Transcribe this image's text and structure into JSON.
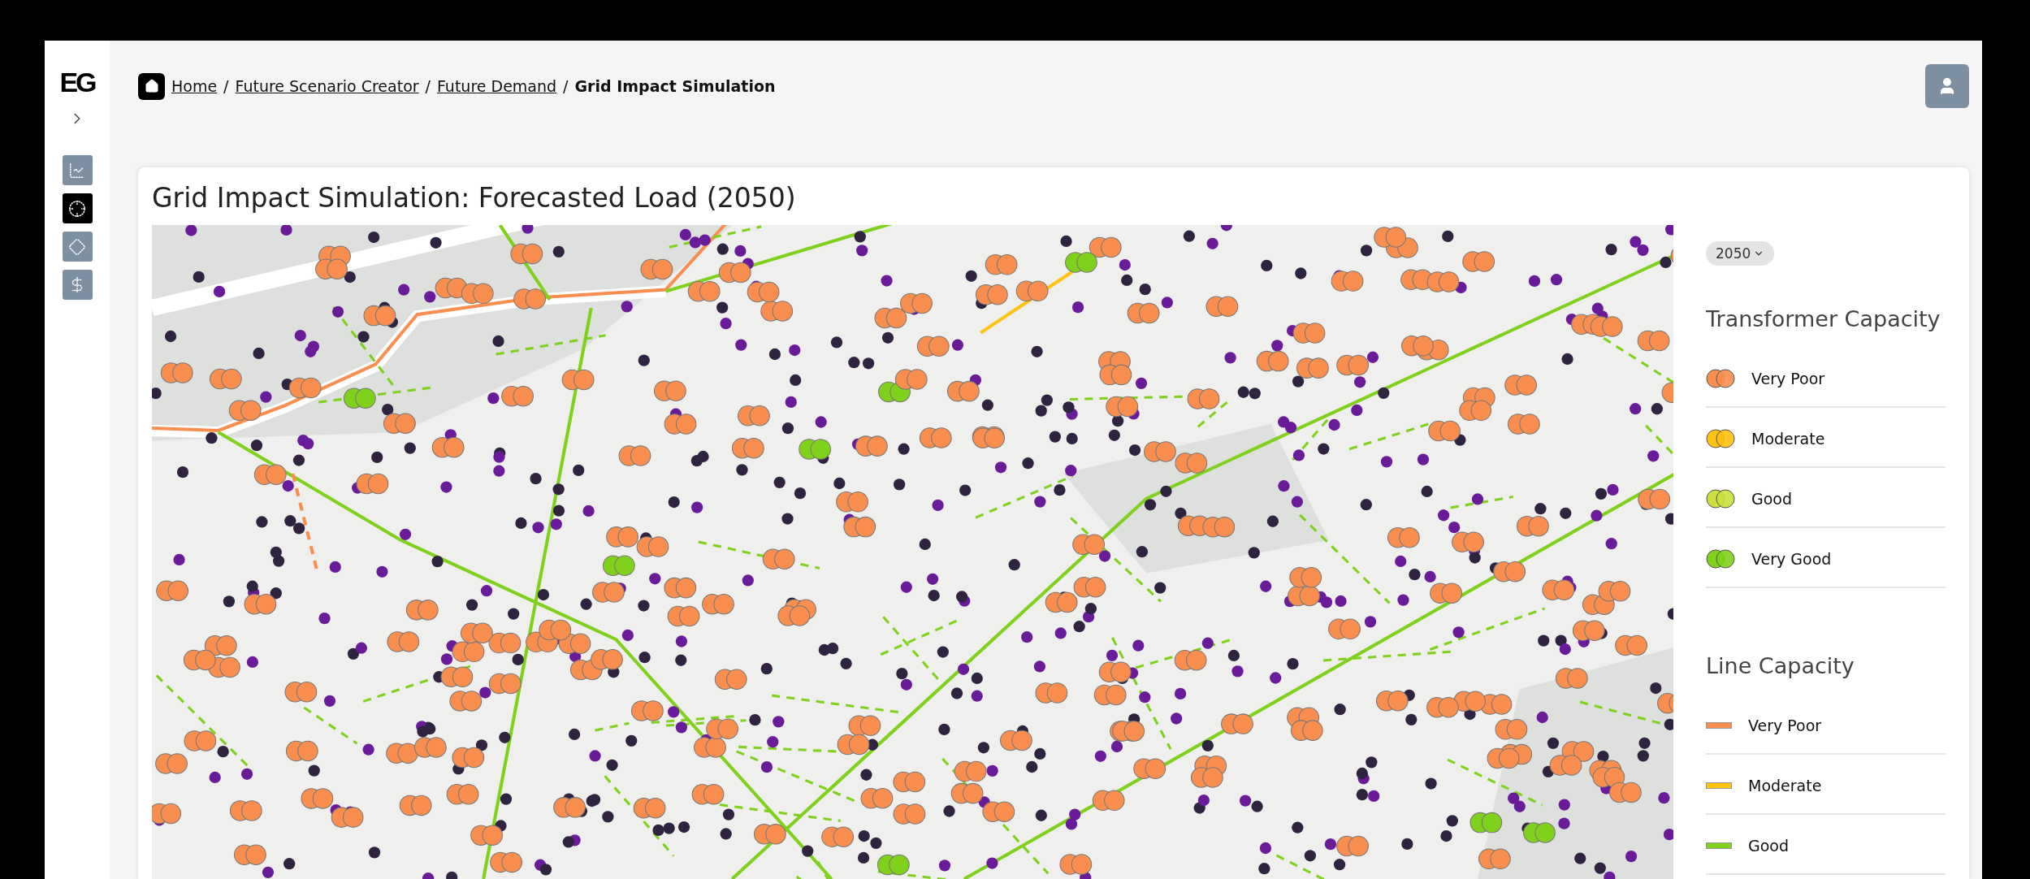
{
  "sidebar": {
    "logo": "EG",
    "nav": [
      {
        "kind": "chart",
        "selected": false
      },
      {
        "kind": "target",
        "selected": true
      },
      {
        "kind": "diamond",
        "selected": false
      },
      {
        "kind": "dollar",
        "selected": false
      }
    ]
  },
  "breadcrumb": {
    "links": [
      "Home",
      "Future Scenario Creator",
      "Future Demand"
    ],
    "separator": "/",
    "current": "Grid Impact Simulation"
  },
  "card": {
    "title": "Grid Impact Simulation: Forecasted Load (2050)",
    "year": "2050",
    "legend": [
      {
        "title": "Transformer Capacity",
        "kind": "transformer",
        "items": [
          {
            "label": "Very Poor",
            "color": "#f98e4e"
          },
          {
            "label": "Moderate",
            "color": "#ffc20e"
          },
          {
            "label": "Good",
            "color": "#cbe03e"
          },
          {
            "label": "Very Good",
            "color": "#7fd11b"
          }
        ]
      },
      {
        "title": "Line Capacity",
        "kind": "line",
        "items": [
          {
            "label": "Very Poor",
            "color": "#f98e4e"
          },
          {
            "label": "Moderate",
            "color": "#ffc20e"
          },
          {
            "label": "Good",
            "color": "#7fd11b"
          }
        ]
      }
    ]
  }
}
